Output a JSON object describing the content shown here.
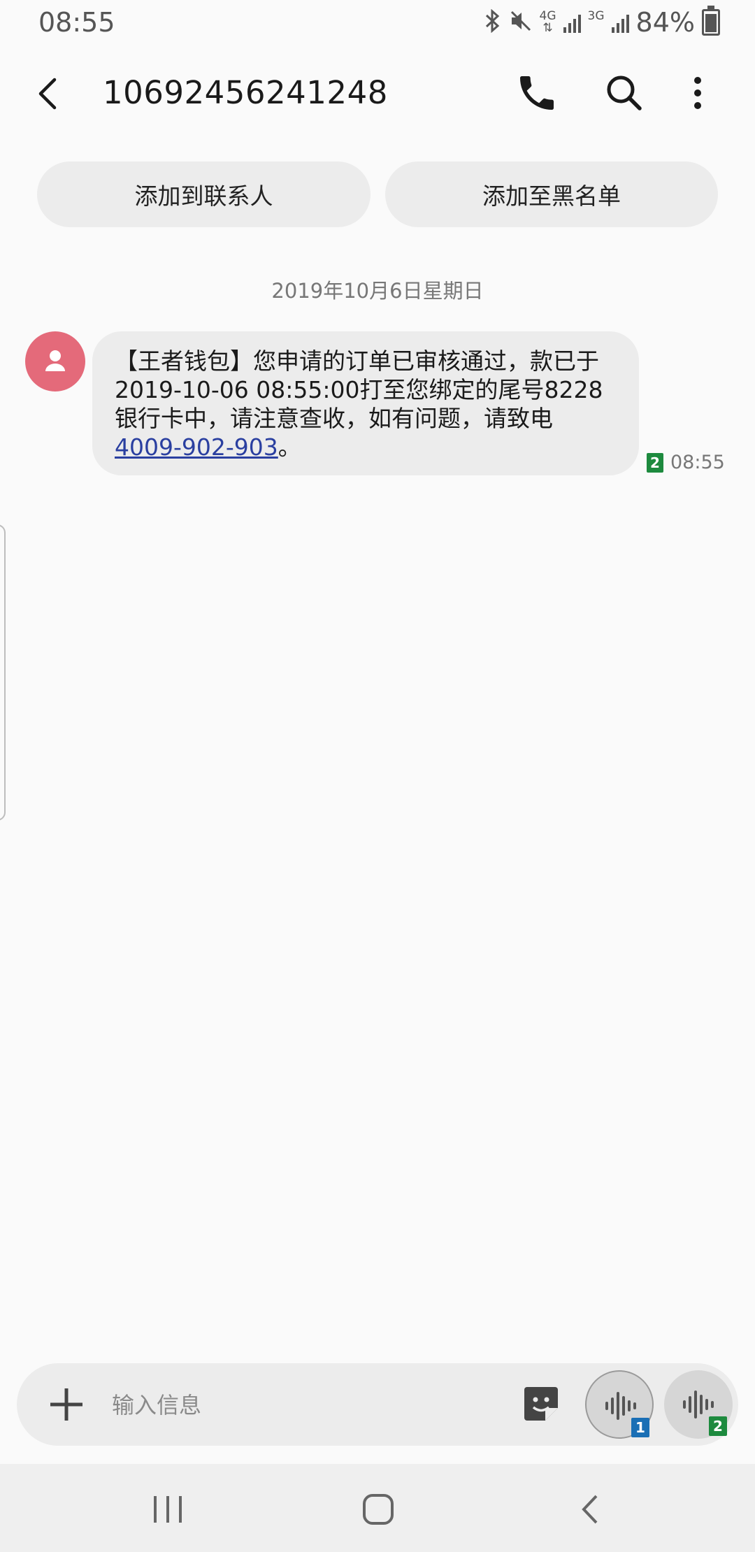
{
  "status_bar": {
    "time": "08:55",
    "network_1": "4G",
    "network_2": "3G",
    "battery_percent": "84%",
    "battery_level": 0.84,
    "icons": [
      "bluetooth-icon",
      "mute-icon",
      "signal-icon",
      "battery-icon"
    ]
  },
  "header": {
    "title": "10692456241248",
    "icons": [
      "back-arrow-icon",
      "phone-icon",
      "search-icon",
      "more-vert-icon"
    ]
  },
  "actions": {
    "add_contact": "添加到联系人",
    "add_blacklist": "添加至黑名单"
  },
  "conversation": {
    "date": "2019年10月6日星期日",
    "messages": [
      {
        "lines": [
          "【王者钱包】您申请的订单已审核通过，款已于",
          "2019-10-06 08:55:00打至您绑定的尾号8228",
          "银行卡中，请注意查收，如有问题，请致电"
        ],
        "link": "4009-902-903",
        "suffix": "。",
        "sim": "2",
        "time": "08:55"
      }
    ]
  },
  "composer": {
    "placeholder": "输入信息",
    "sim1_label": "1",
    "sim2_label": "2"
  },
  "colors": {
    "background": "#fafafa",
    "bubble": "#ececec",
    "avatar": "#e46a7a",
    "link": "#2a3fa0",
    "sim1": "#1a6fb5",
    "sim2": "#1d8a3e"
  }
}
